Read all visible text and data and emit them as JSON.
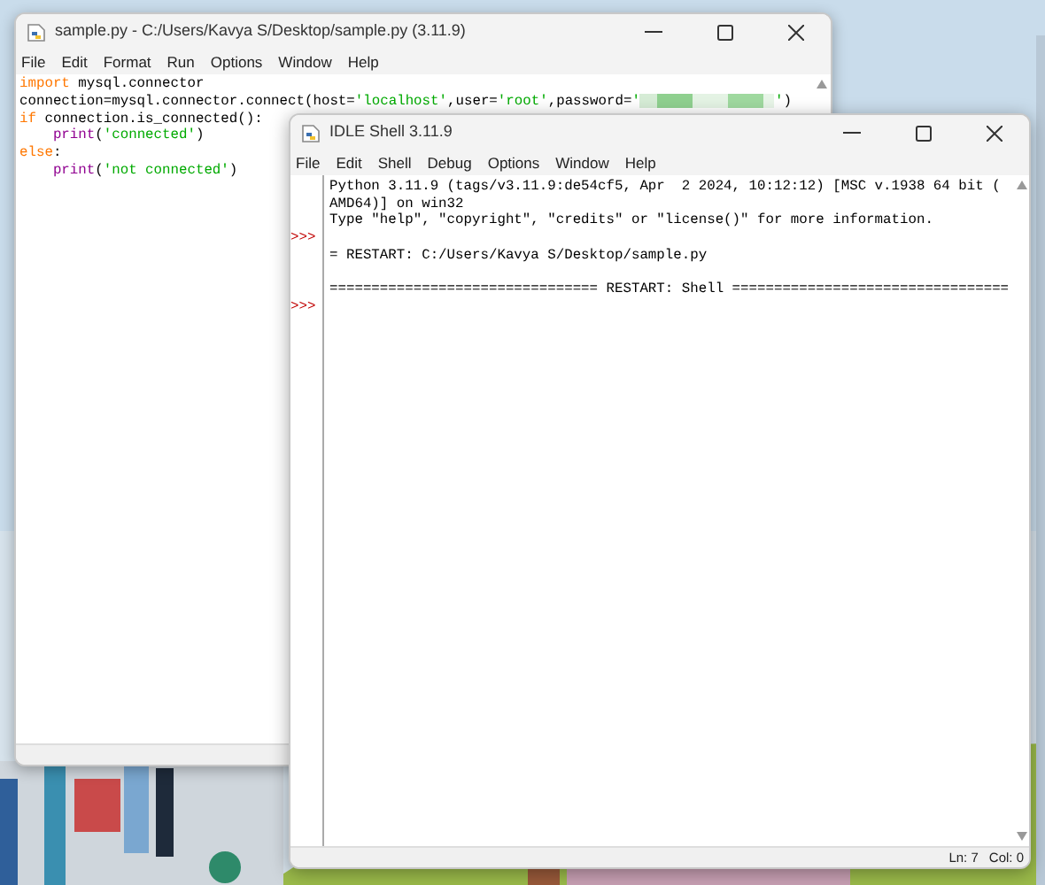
{
  "editor": {
    "title": "sample.py - C:/Users/Kavya S/Desktop/sample.py (3.11.9)",
    "menu": [
      "File",
      "Edit",
      "Format",
      "Run",
      "Options",
      "Window",
      "Help"
    ],
    "code": [
      [
        {
          "t": "import",
          "kind": "keyword"
        },
        {
          "t": " mysql.connector",
          "kind": "plain"
        }
      ],
      [
        {
          "t": "connection=mysql.connector.connect(host=",
          "kind": "plain"
        },
        {
          "t": "'localhost'",
          "kind": "string"
        },
        {
          "t": ",user=",
          "kind": "plain"
        },
        {
          "t": "'root'",
          "kind": "string"
        },
        {
          "t": ",password=",
          "kind": "plain"
        },
        {
          "t": "'",
          "kind": "string"
        },
        {
          "kind": "redacted"
        },
        {
          "t": "'",
          "kind": "string"
        },
        {
          "t": ")",
          "kind": "plain"
        }
      ],
      [
        {
          "t": "if",
          "kind": "keyword"
        },
        {
          "t": " connection.is_connected():",
          "kind": "plain"
        }
      ],
      [
        {
          "t": "print",
          "kind": "builtin",
          "indented": true
        },
        {
          "t": "(",
          "kind": "plain"
        },
        {
          "t": "'connected'",
          "kind": "string"
        },
        {
          "t": ")",
          "kind": "plain"
        }
      ],
      [
        {
          "t": "else",
          "kind": "keyword"
        },
        {
          "t": ":",
          "kind": "plain"
        }
      ],
      [
        {
          "t": "print",
          "kind": "builtin",
          "indented": true
        },
        {
          "t": "(",
          "kind": "plain"
        },
        {
          "t": "'not connected'",
          "kind": "string"
        },
        {
          "t": ")",
          "kind": "plain"
        }
      ]
    ]
  },
  "shell": {
    "title": "IDLE Shell 3.11.9",
    "menu": [
      "File",
      "Edit",
      "Shell",
      "Debug",
      "Options",
      "Window",
      "Help"
    ],
    "lines": [
      {
        "text": "Python 3.11.9 (tags/v3.11.9:de54cf5, Apr  2 2024, 10:12:12) [MSC v.1938 64 bit ("
      },
      {
        "text": "AMD64)] on win32"
      },
      {
        "text": "Type \"help\", \"copyright\", \"credits\" or \"license()\" for more information."
      },
      {
        "prompt": ">>>"
      },
      {
        "text": "= RESTART: C:/Users/Kavya S/Desktop/sample.py"
      },
      {
        "text": "================================ RESTART: Shell =================================",
        "kind": "separator"
      },
      {
        "prompt": ">>>"
      }
    ],
    "status": [
      "Ln: 7",
      "Col: 0"
    ]
  }
}
